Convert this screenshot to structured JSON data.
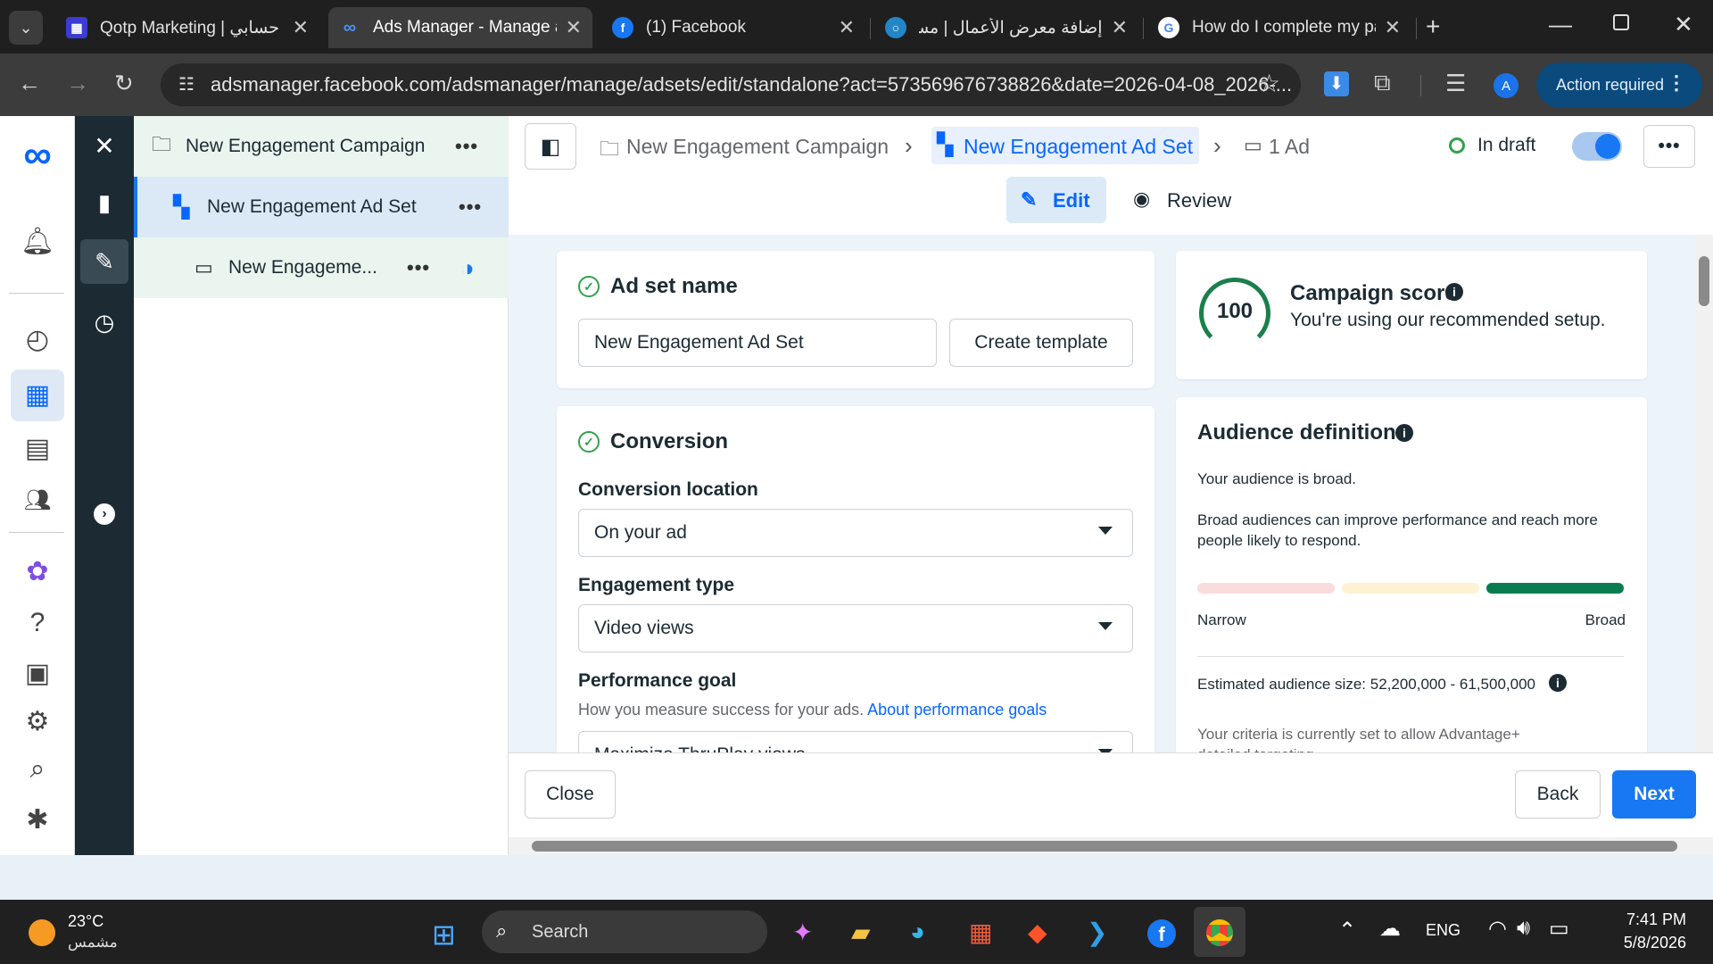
{
  "browser": {
    "tabs": [
      {
        "title": "Qotp Marketing | حسابي",
        "active": false
      },
      {
        "title": "Ads Manager - Manage ads",
        "active": true
      },
      {
        "title": "(1) Facebook",
        "active": false
      },
      {
        "title": "إضافة معرض الأعمال | مستقل",
        "active": false
      },
      {
        "title": "How do I complete my page",
        "active": false
      }
    ],
    "url": "adsmanager.facebook.com/adsmanager/manage/adsets/edit/standalone?act=573569676738826&date=2026-04-08_2026-...",
    "action_required": "Action required",
    "profile_initial": "A"
  },
  "tree": {
    "campaign": "New Engagement Campaign",
    "adset": "New Engagement Ad Set",
    "ad": "New Engageme..."
  },
  "header": {
    "crumb_campaign": "New Engagement Campaign",
    "crumb_adset": "New Engagement Ad Set",
    "crumb_ad": "1 Ad",
    "status": "In draft",
    "edit": "Edit",
    "review": "Review"
  },
  "adset_name": {
    "title": "Ad set name",
    "value": "New Engagement Ad Set",
    "create_template": "Create template"
  },
  "conversion": {
    "title": "Conversion",
    "location_label": "Conversion location",
    "location_value": "On your ad",
    "engagement_label": "Engagement type",
    "engagement_value": "Video views",
    "goal_label": "Performance goal",
    "goal_help": "How you measure success for your ads.",
    "goal_link": "About performance goals",
    "goal_value": "Maximize ThruPlay views"
  },
  "score": {
    "value": "100",
    "title": "Campaign score",
    "subtitle": "You're using our recommended setup."
  },
  "audience": {
    "title": "Audience definition",
    "line1": "Your audience is broad.",
    "line2": "Broad audiences can improve performance and reach more people likely to respond.",
    "narrow": "Narrow",
    "broad": "Broad",
    "size_label": "Estimated audience size:",
    "size_value": "52,200,000 - 61,500,000",
    "criteria": "Your criteria is currently set to allow Advantage+ detailed targeting."
  },
  "footer": {
    "close": "Close",
    "back": "Back",
    "next": "Next"
  },
  "taskbar": {
    "temp": "23°C",
    "weather": "مشمس",
    "search": "Search",
    "lang": "ENG",
    "time": "7:41 PM",
    "date": "5/8/2026"
  },
  "colors": {
    "primary": "#0866ff",
    "next_btn": "#1877f2",
    "dark_rail": "#1c2b33",
    "content_bg": "#ecf4fa",
    "success": "#31a24c"
  }
}
